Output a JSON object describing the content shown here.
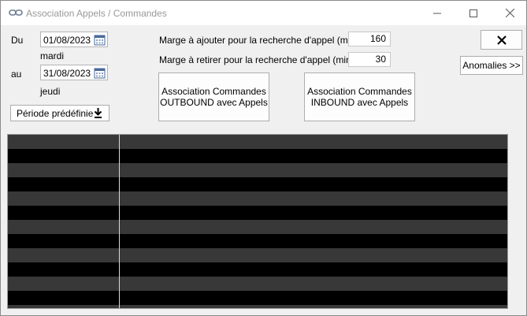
{
  "window": {
    "title": "Association Appels / Commandes"
  },
  "period": {
    "from_label": "Du",
    "from_date": "01/08/2023",
    "from_day": "mardi",
    "to_label": "au",
    "to_date": "31/08/2023",
    "to_day": "jeudi",
    "predefined_button": "Période prédéfinie"
  },
  "margins": {
    "add_label": "Marge à ajouter pour la recherche d'appel (min)",
    "add_value": "160",
    "remove_label": "Marge à retirer pour la recherche d'appel (min)",
    "remove_value": "30"
  },
  "actions": {
    "outbound_line1": "Association Commandes",
    "outbound_line2": "OUTBOUND avec Appels",
    "inbound_line1": "Association Commandes",
    "inbound_line2": "INBOUND avec Appels",
    "anomalies": "Anomalies >>"
  },
  "colors": {
    "grid_row_dark": "#000000",
    "grid_row_alt": "#383838",
    "window_bg": "#f0f0f0"
  }
}
